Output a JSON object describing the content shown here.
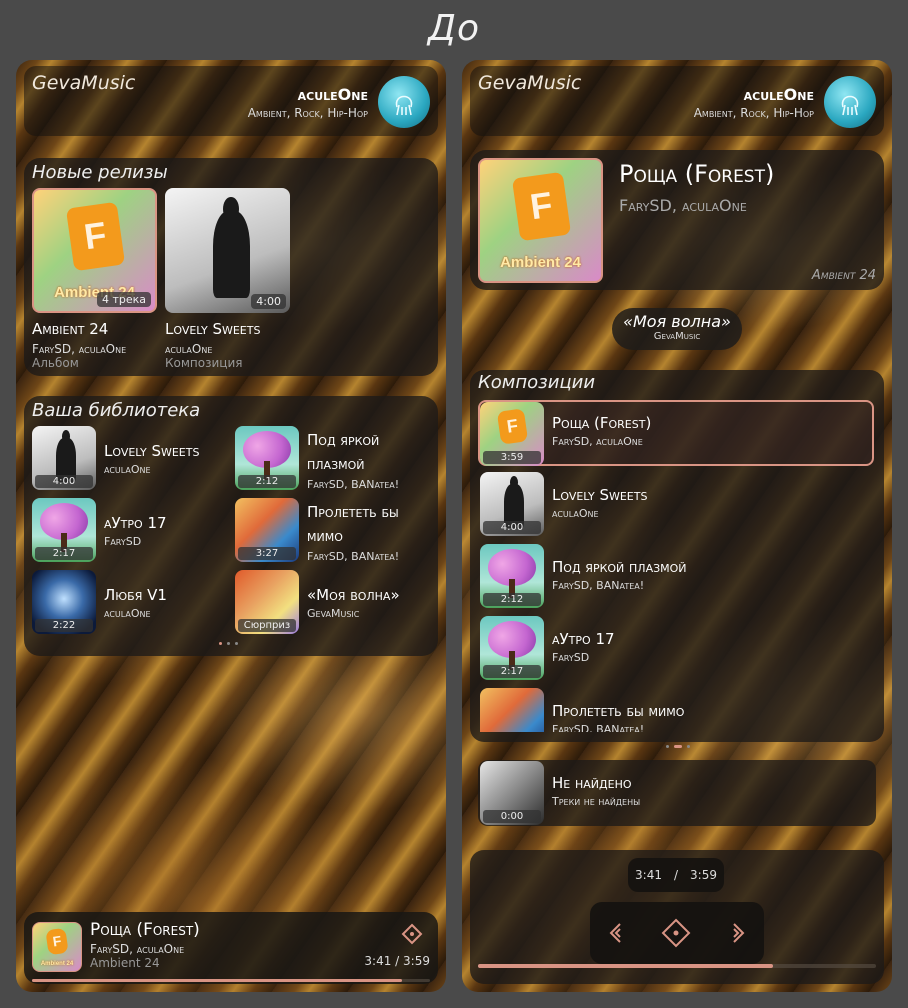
{
  "page_title": "До",
  "left": {
    "brand": "GevaMusic",
    "user": {
      "name": "aculeOne",
      "genres": "Ambient, Rock, Hip-Hop"
    },
    "new_releases": {
      "title": "Новые релизы",
      "items": [
        {
          "title": "Ambient 24",
          "artist": "FarySD, aculaOne",
          "type": "Альбом",
          "badge": "4 трека",
          "cover_text": "Ambient 24"
        },
        {
          "title": "Lovely Sweets",
          "artist": "aculaOne",
          "type": "Композиция",
          "badge": "4:00"
        }
      ]
    },
    "library": {
      "title": "Ваша библиотека",
      "items": [
        {
          "title": "Lovely Sweets",
          "artist": "aculaOne",
          "duration": "4:00"
        },
        {
          "title": "Под яркой плазмой",
          "artist": "FarySD, BANatea!",
          "duration": "2:12"
        },
        {
          "title": "аУтро 17",
          "artist": "FarySD",
          "duration": "2:17"
        },
        {
          "title": "Пролететь бы мимо",
          "artist": "FarySD, BANatea!",
          "duration": "3:27"
        },
        {
          "title": "Любя V1",
          "artist": "aculaOne",
          "duration": "2:22"
        },
        {
          "title": "«Моя волна»",
          "artist": "GevaMusic",
          "duration": "Сюрприз"
        }
      ]
    },
    "now_playing": {
      "title": "Роща (Forest)",
      "artist": "FarySD, aculaOne",
      "album": "Ambient 24",
      "time": "3:41 / 3:59",
      "cover_text": "Ambient 24",
      "progress": 0.93
    }
  },
  "right": {
    "brand": "GevaMusic",
    "user": {
      "name": "aculeOne",
      "genres": "Ambient, Rock, Hip-Hop"
    },
    "release": {
      "title": "Роща (Forest)",
      "artist": "FarySD, aculaOne",
      "album": "Ambient 24",
      "cover_text": "Ambient 24"
    },
    "wave": {
      "title": "«Моя волна»",
      "subtitle": "GevaMusic"
    },
    "tracks": {
      "title": "Композиции",
      "items": [
        {
          "title": "Роща (Forest)",
          "artist": "FarySD, aculaOne",
          "duration": "3:59"
        },
        {
          "title": "Lovely Sweets",
          "artist": "aculaOne",
          "duration": "4:00"
        },
        {
          "title": "Под яркой плазмой",
          "artist": "FarySD, BANatea!",
          "duration": "2:12"
        },
        {
          "title": "аУтро 17",
          "artist": "FarySD",
          "duration": "2:17"
        },
        {
          "title": "Пролететь бы мимо",
          "artist": "FarySD, BANatea!",
          "duration": ""
        }
      ]
    },
    "not_found": {
      "title": "Не найдено",
      "subtitle": "Треки не найдены",
      "duration": "0:00"
    },
    "player": {
      "elapsed": "3:41",
      "separator": "/",
      "total": "3:59",
      "progress": 0.74
    }
  },
  "colors": {
    "accent": "#d99484",
    "panel": "#1c1a18",
    "gold": "#b5842f"
  }
}
